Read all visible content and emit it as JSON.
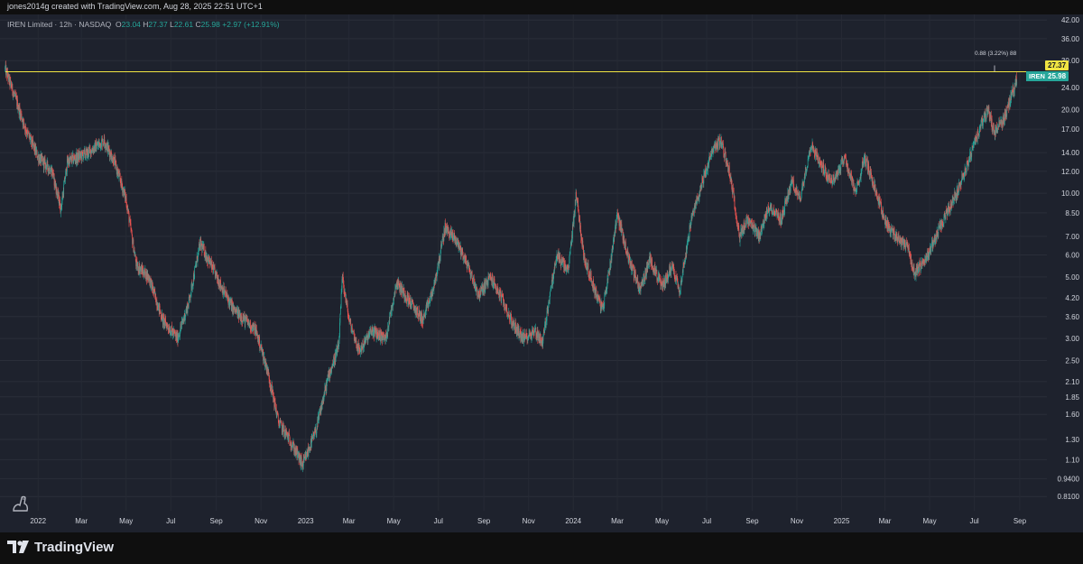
{
  "header": {
    "attribution": "jones2014g created with TradingView.com, Aug 28, 2025 22:51 UTC+1"
  },
  "legend": {
    "symbol": "IREN Limited · 12h · NASDAQ",
    "o_key": "O",
    "o_val": "23.04",
    "h_key": "H",
    "h_val": "27.37",
    "l_key": "L",
    "l_val": "22.61",
    "c_key": "C",
    "c_val": "25.98",
    "change": "+2.97 (+12.91%)"
  },
  "ruler": {
    "label": "0.88 (3.22%) 88"
  },
  "price_tags": {
    "resistance": "27.37",
    "last": "25.98",
    "symbol": "IREN"
  },
  "footer": {
    "brand": "TradingView"
  },
  "colors": {
    "background": "#1e222d",
    "up": "#26a69a",
    "down": "#ef5350",
    "resistance_line": "#f0e442",
    "axis_text": "#d1d4dc"
  },
  "chart_data": {
    "type": "candlestick",
    "symbol": "IREN",
    "interval": "12h",
    "exchange": "NASDAQ",
    "y_scale": "log",
    "ylim": [
      0.72,
      44
    ],
    "y_ticks": [
      "42.00",
      "36.00",
      "30.00",
      "24.00",
      "20.00",
      "17.00",
      "14.00",
      "12.00",
      "10.00",
      "8.50",
      "7.00",
      "6.00",
      "5.00",
      "4.20",
      "3.60",
      "3.00",
      "2.50",
      "2.10",
      "1.85",
      "1.60",
      "1.30",
      "1.10",
      "0.9400",
      "0.8100"
    ],
    "x_ticks": [
      "2022",
      "Mar",
      "May",
      "Jul",
      "Sep",
      "Nov",
      "2023",
      "Mar",
      "May",
      "Jul",
      "Sep",
      "Nov",
      "2024",
      "Mar",
      "May",
      "Jul",
      "Sep",
      "Nov",
      "2025",
      "Mar",
      "May",
      "Jul",
      "Sep"
    ],
    "resistance_level": 27.37,
    "price_path": [
      [
        "2021-11-17",
        28.0
      ],
      [
        "2021-12-01",
        22.0
      ],
      [
        "2021-12-15",
        17.0
      ],
      [
        "2022-01-01",
        13.5
      ],
      [
        "2022-01-20",
        12.0
      ],
      [
        "2022-02-01",
        8.8
      ],
      [
        "2022-02-10",
        13.0
      ],
      [
        "2022-03-10",
        14.0
      ],
      [
        "2022-04-01",
        15.5
      ],
      [
        "2022-04-15",
        13.0
      ],
      [
        "2022-05-01",
        9.5
      ],
      [
        "2022-05-15",
        5.5
      ],
      [
        "2022-06-01",
        5.0
      ],
      [
        "2022-06-20",
        3.5
      ],
      [
        "2022-07-10",
        3.0
      ],
      [
        "2022-07-25",
        4.0
      ],
      [
        "2022-08-10",
        6.6
      ],
      [
        "2022-08-25",
        5.5
      ],
      [
        "2022-09-10",
        4.5
      ],
      [
        "2022-09-25",
        3.8
      ],
      [
        "2022-10-10",
        3.5
      ],
      [
        "2022-10-25",
        3.2
      ],
      [
        "2022-11-10",
        2.3
      ],
      [
        "2022-11-25",
        1.5
      ],
      [
        "2022-12-10",
        1.3
      ],
      [
        "2022-12-28",
        1.05
      ],
      [
        "2023-01-15",
        1.4
      ],
      [
        "2023-02-01",
        2.2
      ],
      [
        "2023-02-15",
        2.8
      ],
      [
        "2023-02-20",
        5.0
      ],
      [
        "2023-03-01",
        3.5
      ],
      [
        "2023-03-15",
        2.7
      ],
      [
        "2023-04-01",
        3.2
      ],
      [
        "2023-04-20",
        3.0
      ],
      [
        "2023-05-05",
        4.8
      ],
      [
        "2023-05-25",
        4.0
      ],
      [
        "2023-06-10",
        3.5
      ],
      [
        "2023-06-25",
        4.6
      ],
      [
        "2023-07-10",
        7.5
      ],
      [
        "2023-07-25",
        6.8
      ],
      [
        "2023-08-10",
        5.5
      ],
      [
        "2023-08-25",
        4.3
      ],
      [
        "2023-09-10",
        5.0
      ],
      [
        "2023-09-25",
        4.2
      ],
      [
        "2023-10-10",
        3.4
      ],
      [
        "2023-10-25",
        3.0
      ],
      [
        "2023-11-10",
        3.2
      ],
      [
        "2023-11-20",
        2.9
      ],
      [
        "2023-12-01",
        4.5
      ],
      [
        "2023-12-10",
        6.0
      ],
      [
        "2023-12-25",
        5.2
      ],
      [
        "2024-01-05",
        10.0
      ],
      [
        "2024-01-15",
        6.0
      ],
      [
        "2024-01-30",
        4.5
      ],
      [
        "2024-02-10",
        3.8
      ],
      [
        "2024-02-20",
        5.5
      ],
      [
        "2024-03-01",
        8.5
      ],
      [
        "2024-03-15",
        6.0
      ],
      [
        "2024-04-01",
        4.5
      ],
      [
        "2024-04-15",
        5.8
      ],
      [
        "2024-05-01",
        4.6
      ],
      [
        "2024-05-15",
        5.5
      ],
      [
        "2024-05-25",
        4.5
      ],
      [
        "2024-06-10",
        8.0
      ],
      [
        "2024-06-25",
        11.0
      ],
      [
        "2024-07-10",
        14.5
      ],
      [
        "2024-07-20",
        15.5
      ],
      [
        "2024-08-01",
        12.0
      ],
      [
        "2024-08-15",
        7.0
      ],
      [
        "2024-08-25",
        8.0
      ],
      [
        "2024-09-10",
        7.0
      ],
      [
        "2024-09-25",
        9.0
      ],
      [
        "2024-10-10",
        8.0
      ],
      [
        "2024-10-25",
        11.0
      ],
      [
        "2024-11-05",
        9.5
      ],
      [
        "2024-11-20",
        15.0
      ],
      [
        "2024-12-05",
        12.5
      ],
      [
        "2024-12-20",
        11.0
      ],
      [
        "2025-01-05",
        13.5
      ],
      [
        "2025-01-20",
        10.0
      ],
      [
        "2025-02-01",
        13.5
      ],
      [
        "2025-02-15",
        10.5
      ],
      [
        "2025-03-01",
        8.0
      ],
      [
        "2025-03-15",
        7.0
      ],
      [
        "2025-04-01",
        6.5
      ],
      [
        "2025-04-10",
        5.1
      ],
      [
        "2025-04-25",
        5.8
      ],
      [
        "2025-05-10",
        7.0
      ],
      [
        "2025-05-25",
        8.5
      ],
      [
        "2025-06-10",
        10.5
      ],
      [
        "2025-06-25",
        13.5
      ],
      [
        "2025-07-10",
        17.5
      ],
      [
        "2025-07-20",
        20.0
      ],
      [
        "2025-07-28",
        16.5
      ],
      [
        "2025-08-10",
        18.5
      ],
      [
        "2025-08-20",
        22.0
      ],
      [
        "2025-08-28",
        25.98
      ]
    ]
  }
}
